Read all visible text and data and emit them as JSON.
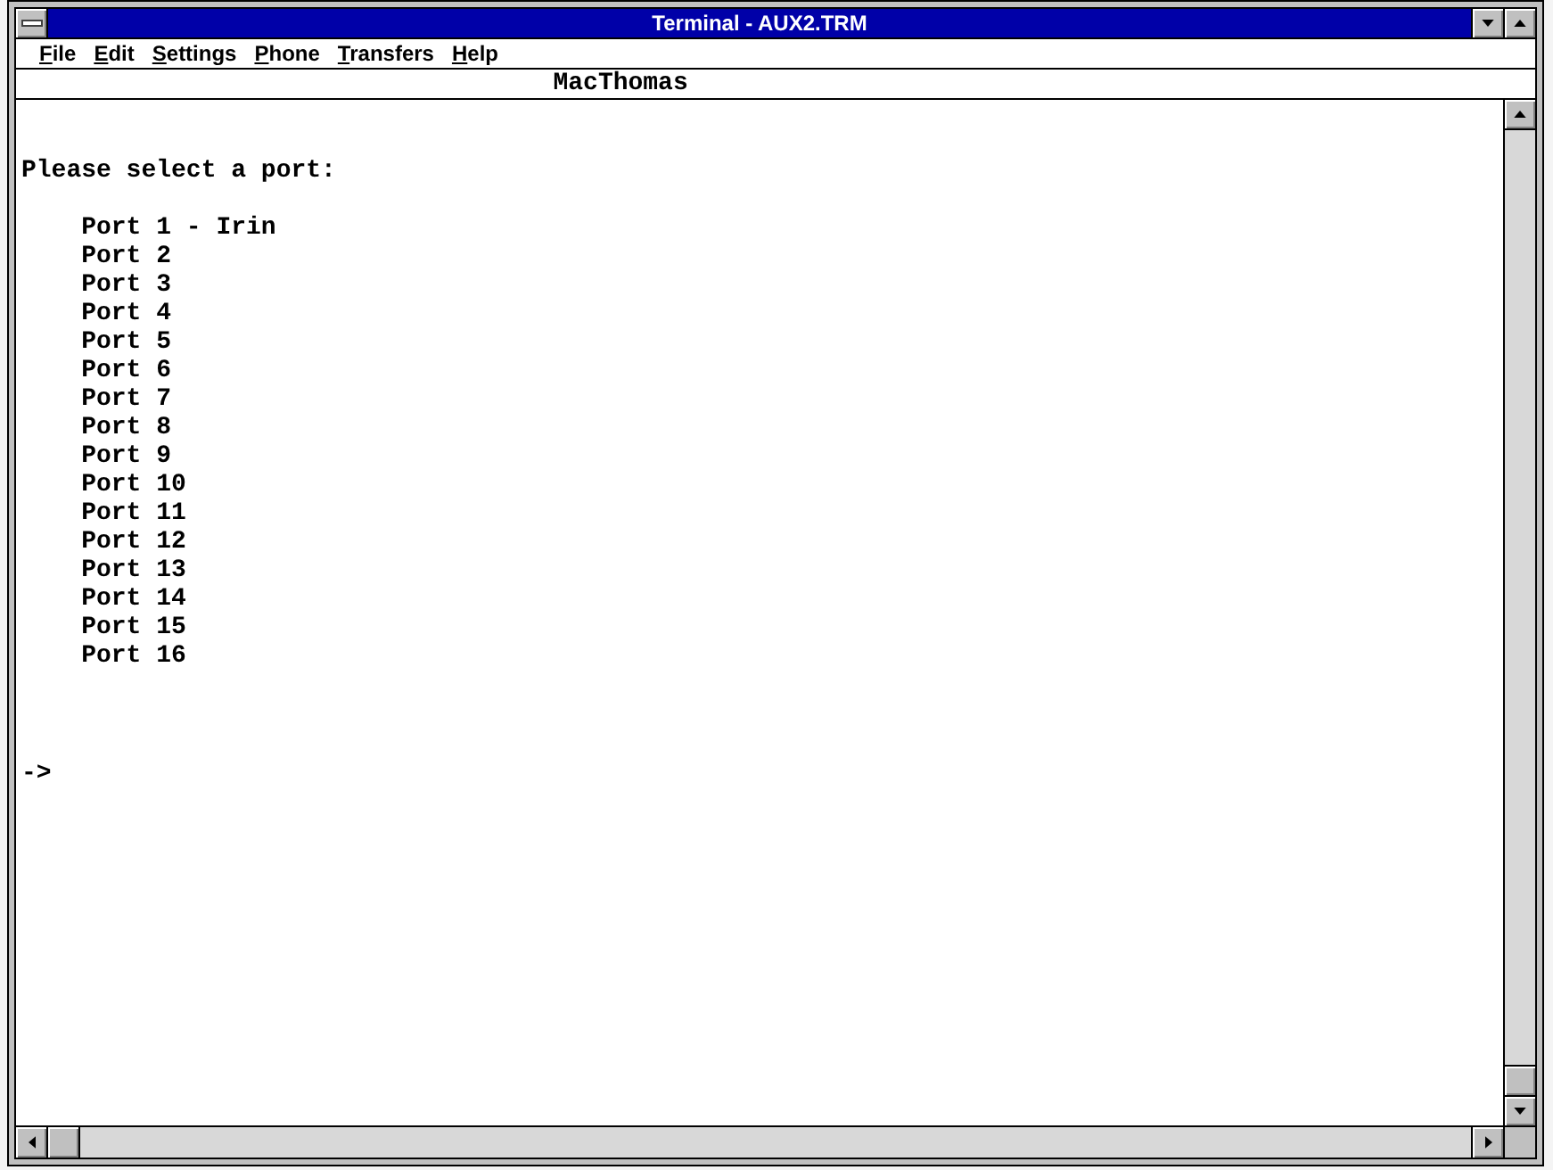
{
  "window": {
    "title": "Terminal - AUX2.TRM"
  },
  "menu_bar": [
    "File",
    "Edit",
    "Settings",
    "Phone",
    "Transfers",
    "Help"
  ],
  "terminal": {
    "header": "MacThomas",
    "heading": "Please select a port:",
    "ports": [
      "Port 1 - Irin",
      "Port 2",
      "Port 3",
      "Port 4",
      "Port 5",
      "Port 6",
      "Port 7",
      "Port 8",
      "Port 9",
      "Port 10",
      "Port 11",
      "Port 12",
      "Port 13",
      "Port 14",
      "Port 15",
      "Port 16"
    ],
    "prompt": "->"
  }
}
